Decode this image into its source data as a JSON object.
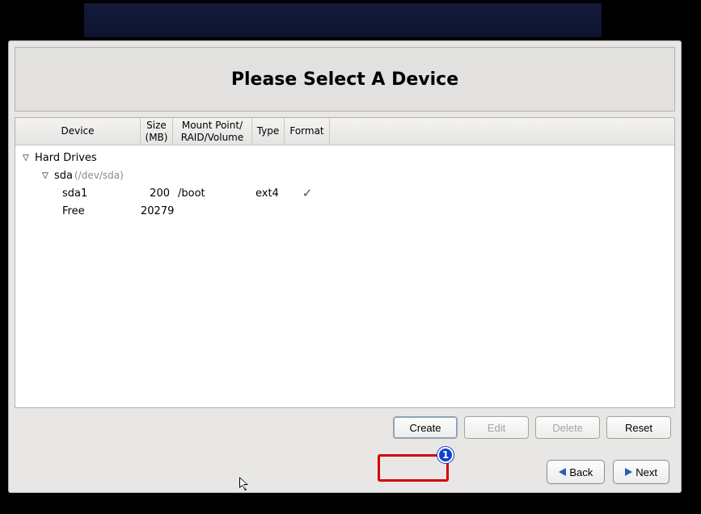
{
  "title": "Please Select A Device",
  "columns": {
    "device": "Device",
    "size_line1": "Size",
    "size_line2": "(MB)",
    "mount_line1": "Mount Point/",
    "mount_line2": "RAID/Volume",
    "type": "Type",
    "format": "Format"
  },
  "tree": {
    "root_label": "Hard Drives",
    "disk": {
      "label": "sda",
      "path": "(/dev/sda)"
    },
    "partitions": [
      {
        "name": "sda1",
        "size": "200",
        "mount": "/boot",
        "type": "ext4",
        "format_check": "✓"
      },
      {
        "name": "Free",
        "size": "20279",
        "mount": "",
        "type": "",
        "format_check": ""
      }
    ]
  },
  "actions": {
    "create": "Create",
    "edit": "Edit",
    "delete": "Delete",
    "reset": "Reset"
  },
  "nav": {
    "back": "Back",
    "next": "Next"
  },
  "annotation": {
    "number": "1"
  }
}
